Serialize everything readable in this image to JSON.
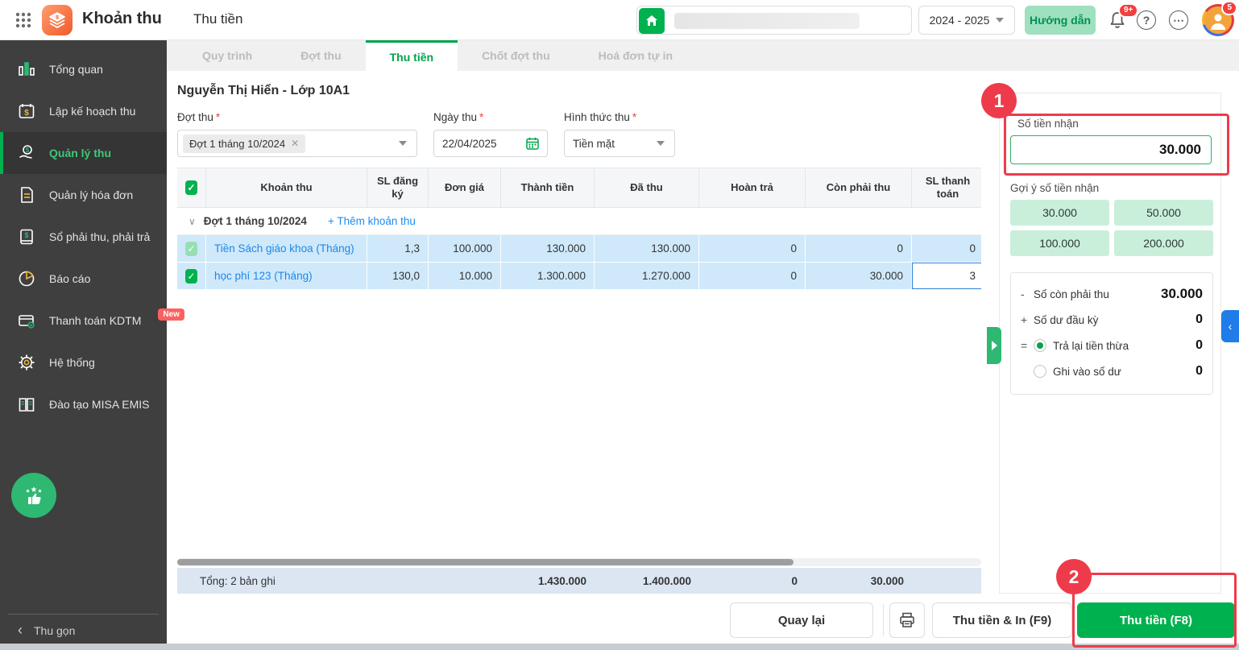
{
  "header": {
    "app_title": "Khoản thu",
    "breadcrumb": "Thu tiền",
    "school_year": "2024 - 2025",
    "guide_button": "Hướng dẫn",
    "bell_badge": "9+",
    "avatar_badge": "5",
    "help_glyph": "?",
    "more_glyph": "⋯"
  },
  "sidebar": {
    "items": [
      {
        "label": "Tổng quan"
      },
      {
        "label": "Lập kế hoạch thu"
      },
      {
        "label": "Quản lý thu"
      },
      {
        "label": "Quản lý hóa đơn"
      },
      {
        "label": "Sổ phải thu, phải trả"
      },
      {
        "label": "Báo cáo"
      },
      {
        "label": "Thanh toán KDTM",
        "badge": "New"
      },
      {
        "label": "Hệ thống"
      },
      {
        "label": "Đào tạo MISA EMIS"
      }
    ],
    "collapse_label": "Thu gọn",
    "collapse_chevron": "‹"
  },
  "tabs": {
    "items": [
      {
        "label": "Quy trình"
      },
      {
        "label": "Đợt thu"
      },
      {
        "label": "Thu tiền"
      },
      {
        "label": "Chốt đợt thu"
      },
      {
        "label": "Hoá đơn tự in"
      }
    ]
  },
  "content": {
    "student_title": "Nguyễn Thị Hiển - Lớp 10A1",
    "required_marker": "*",
    "fields": {
      "batch": {
        "label": "Đợt thu",
        "value": "Đợt 1 tháng 10/2024",
        "remove_glyph": "✕"
      },
      "date": {
        "label": "Ngày thu",
        "value": "22/04/2025"
      },
      "method": {
        "label": "Hình thức thu",
        "value": "Tiền mặt"
      }
    }
  },
  "table": {
    "cols": [
      "Khoản thu",
      "SL đăng ký",
      "Đơn giá",
      "Thành tiền",
      "Đã thu",
      "Hoàn trả",
      "Còn phải thu",
      "SL thanh toán"
    ],
    "group_chevron": "∨",
    "group_label": "Đợt 1 tháng 10/2024",
    "add_link": "+ Thêm khoản thu",
    "check_glyph": "✓",
    "rows": [
      {
        "name": "Tiền Sách giáo khoa (Tháng)",
        "qty": "1,3",
        "price": "100.000",
        "amount": "130.000",
        "paid": "130.000",
        "refund": "0",
        "remain": "0",
        "pay_qty": "0"
      },
      {
        "name": "học phí 123 (Tháng)",
        "qty": "130,0",
        "price": "10.000",
        "amount": "1.300.000",
        "paid": "1.270.000",
        "refund": "0",
        "remain": "30.000",
        "pay_qty": "3"
      }
    ],
    "total": {
      "label": "Tổng: 2 bản ghi",
      "amount": "1.430.000",
      "paid": "1.400.000",
      "refund": "0",
      "remain": "30.000"
    }
  },
  "panel": {
    "amount_label": "Số tiền nhận",
    "amount_value": "30.000",
    "suggest_label": "Gợi ý số tiền nhận",
    "suggestions": [
      "30.000",
      "50.000",
      "100.000",
      "200.000"
    ],
    "summary": {
      "row1": {
        "op": "-",
        "label": "Số còn phải thu",
        "value": "30.000"
      },
      "row2": {
        "op": "+",
        "label": "Số dư đầu kỳ",
        "value": "0"
      },
      "row3": {
        "op": "=",
        "label": "Trả lại tiền thừa",
        "value": "0"
      },
      "row4": {
        "op": "",
        "label": "Ghi vào số dư",
        "value": "0"
      }
    },
    "collapse_chevron": "‹"
  },
  "footer": {
    "back": "Quay lại",
    "collect_print": "Thu tiền & In (F9)",
    "collect": "Thu tiền (F8)"
  },
  "annotations": {
    "step1": "1",
    "step2": "2"
  },
  "colors": {
    "primary_green": "#00b14f",
    "active_tab_green": "#00a44b",
    "annotation_red": "#ee3b4b",
    "row_blue": "#cfe9fb",
    "link_blue": "#1f87e8"
  }
}
